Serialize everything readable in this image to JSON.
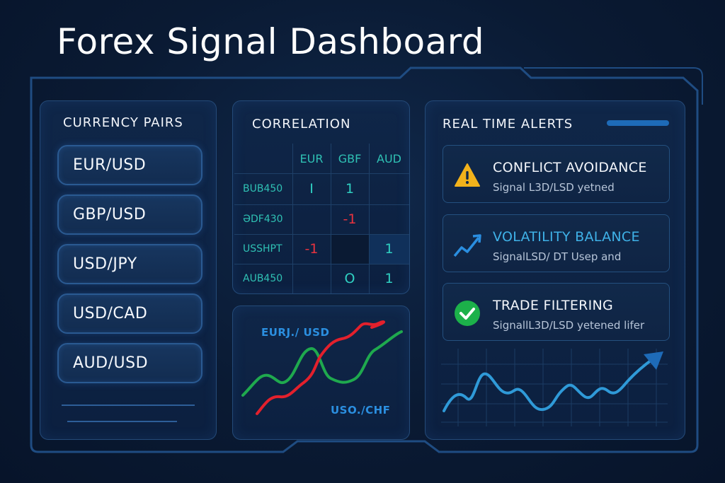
{
  "page": {
    "title": "Forex Signal Dashboard"
  },
  "currency_pairs": {
    "title": "CURRENCY PAIRS",
    "items": [
      "EUR/USD",
      "GBP/USD",
      "USD/JPY",
      "USD/CAD",
      "AUD/USD"
    ]
  },
  "correlation": {
    "title": "CORRELATION",
    "columns": [
      "EUR",
      "GBF",
      "AUD"
    ],
    "rows": [
      {
        "label": "BUB450",
        "cells": [
          "I",
          "1",
          ""
        ]
      },
      {
        "label": "ƏDF430",
        "cells": [
          "",
          "-1",
          ""
        ]
      },
      {
        "label": "USSHPT",
        "cells": [
          "-1",
          "",
          "1"
        ]
      },
      {
        "label": "AUB450",
        "cells": [
          "",
          "O",
          "1"
        ]
      }
    ]
  },
  "pair_chart": {
    "label_top": "EURJ./ USD",
    "label_bottom": "USO./CHF",
    "colors": {
      "green": "#1fa94e",
      "red": "#e3202c"
    }
  },
  "alerts": {
    "title": "REAL TIME ALERTS",
    "items": [
      {
        "title": "CONFLICT AVOIDANCE",
        "subtitle": "Signal L3D/LSD yetned",
        "icon": "warning-icon",
        "title_color": "#f3f6fb"
      },
      {
        "title": "VOLATILITY BALANCE",
        "subtitle": "SignalLSD/ DT  Usep and",
        "icon": "trend-up-icon",
        "title_color": "#3fb2e8"
      },
      {
        "title": "TRADE FILTERING",
        "subtitle": "SignallL3D/LSD yetened lifer",
        "icon": "check-circle-icon",
        "title_color": "#f3f6fb"
      }
    ]
  },
  "colors": {
    "accent": "#1e6bb8",
    "positive": "#2fd0c2",
    "negative": "#e8333f",
    "warning": "#f2b21b",
    "success": "#1cb14a"
  }
}
